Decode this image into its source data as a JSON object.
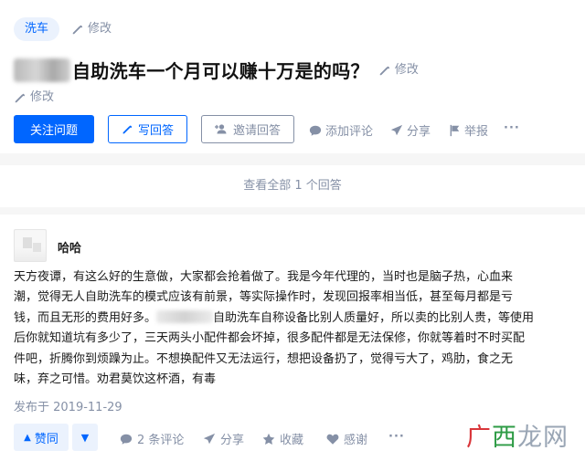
{
  "question": {
    "tag": "洗车",
    "edit_label": "修改",
    "title": "自助洗车一个月可以赚十万是的吗？",
    "buttons": {
      "follow": "关注问题",
      "write_answer": "写回答",
      "invite": "邀请回答"
    },
    "actions": {
      "comment": "添加评论",
      "share": "分享",
      "report": "举报",
      "more": "···"
    }
  },
  "view_all": "查看全部 1 个回答",
  "answer": {
    "author": "哈哈",
    "lines": [
      "天方夜谭，有这么好的生意做，大家都会抢着做了。我是今年代理的，当时也是脑子热，心血来",
      "潮，觉得无人自助洗车的模式应该有前景，等实际操作时，发现回报率相当低，甚至每月都是亏",
      "钱，而且无形的费用好多。",
      "自助洗车自称设备比别人质量好，所以卖的比别人贵，等使用",
      "后你就知道坑有多少了，三天两头小配件都会坏掉，很多配件都是无法保修，你就等着时不时买配",
      "件吧，折腾你到烦躁为止。不想换配件又无法运行，想把设备扔了，觉得亏大了，鸡肋，食之无",
      "味，弃之可惜。劝君莫饮这杯酒，有毒"
    ],
    "date": "发布于 2019-11-29",
    "vote_up": "赞同",
    "actions": {
      "comments": "2 条评论",
      "share": "分享",
      "collect": "收藏",
      "thanks": "感谢",
      "more": "···"
    }
  },
  "watermark": {
    "part1": "广",
    "part2": "西",
    "part3": "龙网"
  }
}
